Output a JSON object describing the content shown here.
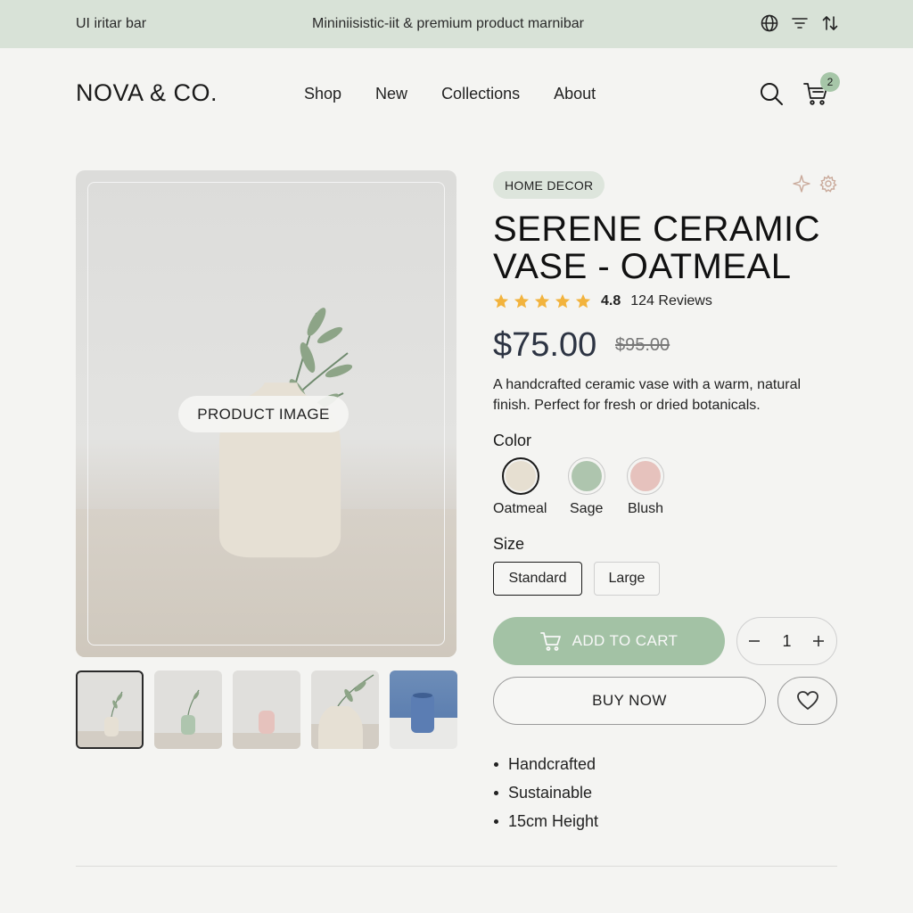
{
  "topbar": {
    "left_text": "UI iritar bar",
    "center_text": "Mininiisistic-iit & premium product marnibar",
    "icons": [
      "globe-icon",
      "filter-icon",
      "sort-icon"
    ]
  },
  "header": {
    "logo": "NOVA & CO.",
    "nav": [
      "Shop",
      "New",
      "Collections",
      "About"
    ],
    "cart_count": "2"
  },
  "gallery": {
    "placeholder_label": "PRODUCT IMAGE",
    "thumbnails": [
      "oatmeal-vase",
      "sage-vase",
      "blush-vase",
      "vase-closeup",
      "blue-cup"
    ],
    "active_thumbnail": 0
  },
  "product": {
    "category": "HOME DECOR",
    "title": "SERENE CERAMIC VASE - OATMEAL",
    "rating": "4.8",
    "rating_stars": 5,
    "reviews": "124 Reviews",
    "price": "$75.00",
    "old_price": "$95.00",
    "description": "A handcrafted ceramic vase with a warm, natural finish. Perfect for fresh or dried botanicals.",
    "color_label": "Color",
    "colors": [
      {
        "name": "Oatmeal",
        "hex": "#e6dfd1",
        "selected": true
      },
      {
        "name": "Sage",
        "hex": "#aec5ae",
        "selected": false
      },
      {
        "name": "Blush",
        "hex": "#e6c2bd",
        "selected": false
      }
    ],
    "size_label": "Size",
    "sizes": [
      "Standard",
      "Large"
    ],
    "selected_size": "Standard",
    "add_to_cart": "ADD TO CART",
    "quantity": "1",
    "buy_now": "BUY NOW",
    "features": [
      "Handcrafted",
      "Sustainable",
      "15cm Height"
    ]
  },
  "colors": {
    "accent": "#a3c2a5",
    "topbar_bg": "#d8e2d7",
    "star": "#f2b33d",
    "price": "#2d3443"
  }
}
